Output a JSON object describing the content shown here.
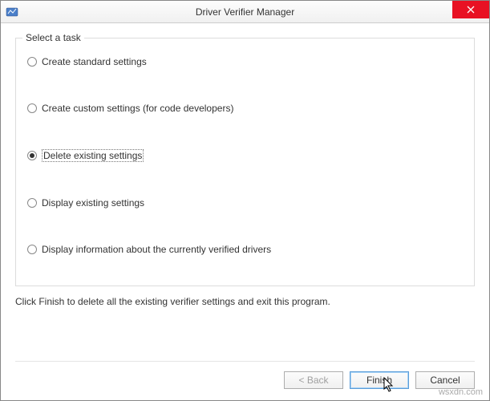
{
  "window": {
    "title": "Driver Verifier Manager"
  },
  "group": {
    "label": "Select a task",
    "options": [
      {
        "label": "Create standard settings",
        "checked": false
      },
      {
        "label": "Create custom settings (for code developers)",
        "checked": false
      },
      {
        "label": "Delete existing settings",
        "checked": true
      },
      {
        "label": "Display existing settings",
        "checked": false
      },
      {
        "label": "Display information about the currently verified drivers",
        "checked": false
      }
    ]
  },
  "instruction": "Click Finish to delete all the existing verifier settings and exit this program.",
  "buttons": {
    "back": "< Back",
    "finish": "Finish",
    "cancel": "Cancel"
  },
  "watermark": "wsxdn.com"
}
